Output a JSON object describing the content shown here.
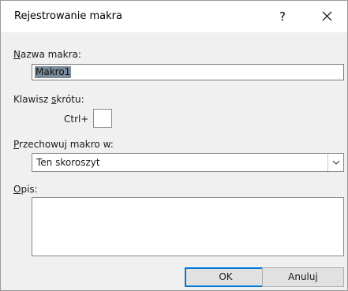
{
  "window": {
    "title": "Rejestrowanie makra",
    "help_glyph": "?",
    "close_icon": "close-icon"
  },
  "macro_name": {
    "label_hotkey": "N",
    "label_rest": "azwa makra:",
    "value": "Makro1"
  },
  "shortcut": {
    "label_pre": "Klawisz ",
    "label_hotkey": "s",
    "label_rest": "krótu:",
    "prefix": "Ctrl+",
    "value": ""
  },
  "store_in": {
    "label_hotkey": "P",
    "label_rest": "rzechowuj makro w:",
    "selected": "Ten skoroszyt",
    "dropdown_icon": "chevron-down-icon"
  },
  "description": {
    "label_hotkey": "O",
    "label_rest": "pis:",
    "value": ""
  },
  "buttons": {
    "ok_label": "OK",
    "cancel_label": "Anuluj"
  },
  "colors": {
    "selection": "#7a8c99",
    "default_button_border": "#0078d7",
    "dialog_background": "#f0f0f0"
  }
}
